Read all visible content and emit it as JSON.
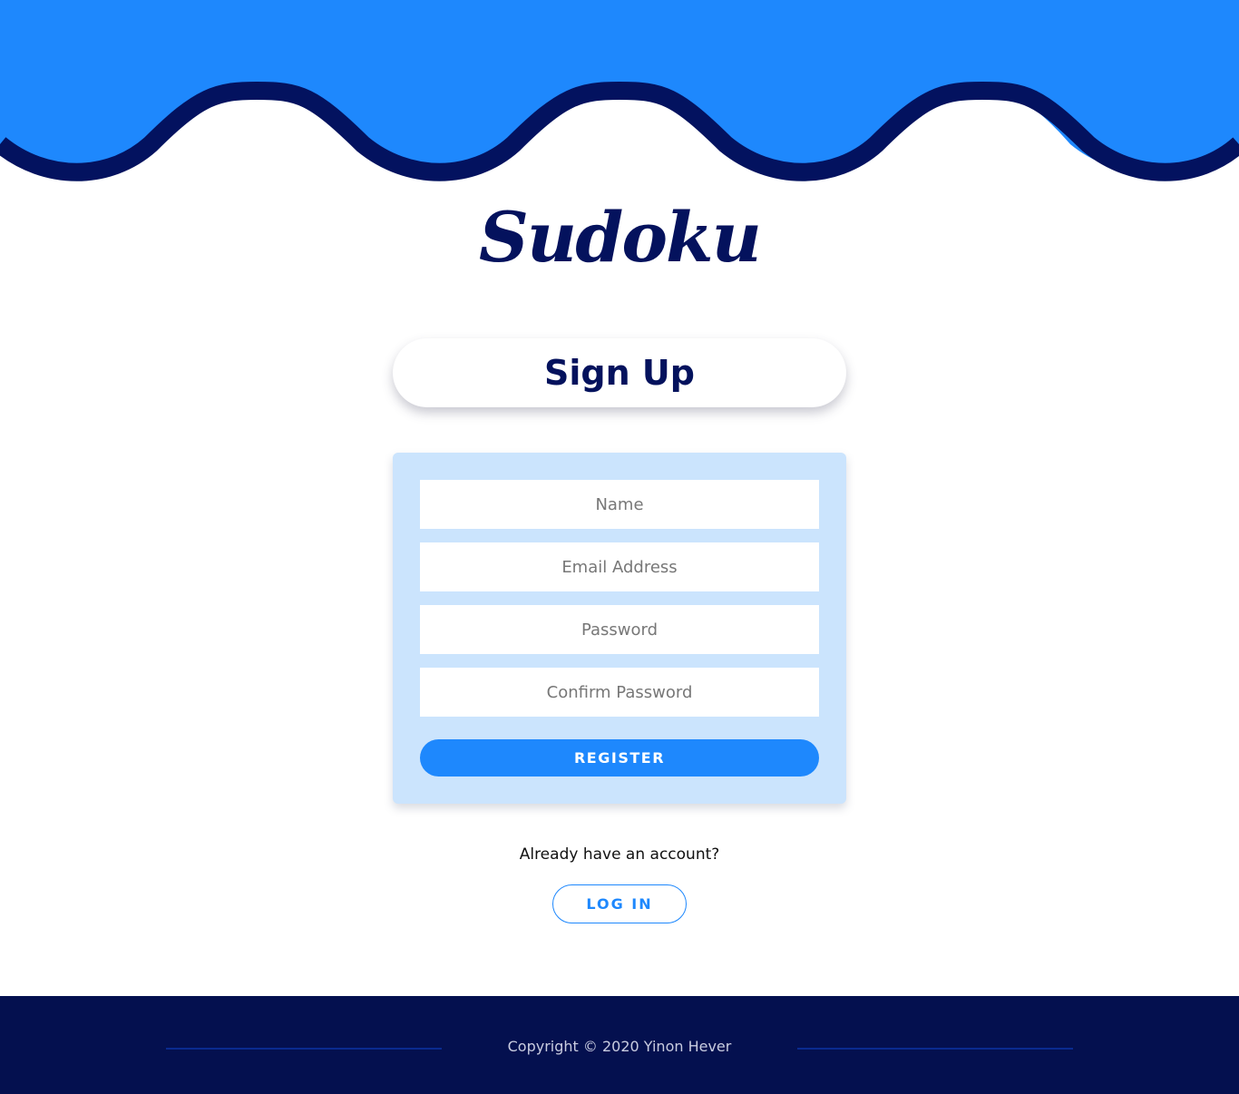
{
  "colors": {
    "header_blue": "#1e88fd",
    "wave_border_navy": "#03125f",
    "logo_navy": "#04125d",
    "card_bg": "#cbe4fd",
    "accent": "#1e88fd",
    "footer_bg": "#04104f"
  },
  "header": {
    "logo": "Sudoku"
  },
  "main": {
    "title": "Sign Up",
    "form": {
      "name_placeholder": "Name",
      "email_placeholder": "Email Address",
      "password_placeholder": "Password",
      "confirm_placeholder": "Confirm Password",
      "register_label": "REGISTER"
    },
    "already_text": "Already have an account?",
    "login_label": "LOG IN"
  },
  "footer": {
    "copyright": "Copyright © 2020 Yinon Hever"
  }
}
